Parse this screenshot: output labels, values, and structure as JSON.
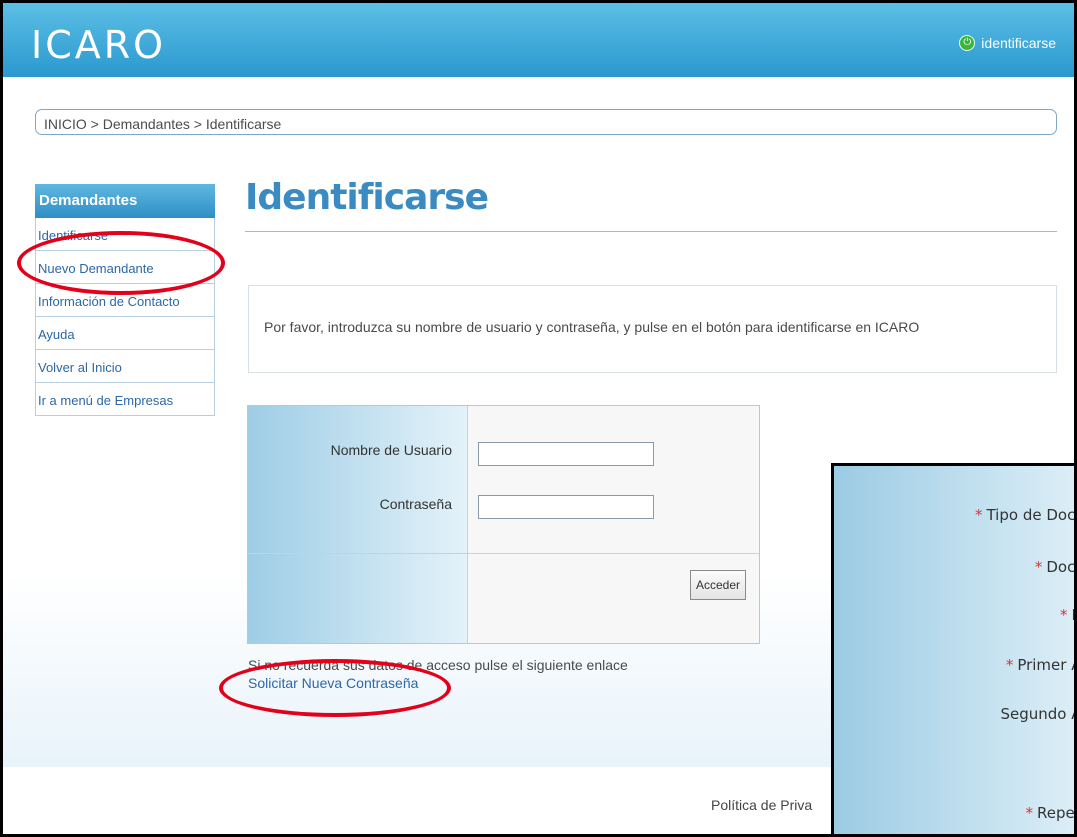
{
  "header": {
    "logo": "ICARO",
    "login_label": "identificarse",
    "login_icon": "power-icon"
  },
  "breadcrumb": "INICIO > Demandantes > Identificarse",
  "sidebar": {
    "title": "Demandantes",
    "items": [
      {
        "label": "Identificarse"
      },
      {
        "label": "Nuevo Demandante"
      },
      {
        "label": "Información de Contacto"
      },
      {
        "label": "Ayuda"
      },
      {
        "label": "Volver al Inicio"
      },
      {
        "label": "Ir a menú de Empresas"
      }
    ]
  },
  "main": {
    "title": "Identificarse",
    "instructions": "Por favor, introduzca su nombre de usuario y contraseña, y pulse en el botón para identificarse en ICARO",
    "form": {
      "username_label": "Nombre de Usuario",
      "username_value": "",
      "password_label": "Contraseña",
      "password_value": "",
      "submit_label": "Acceder"
    },
    "recover_text": "Si no recuerda sus datos de acceso pulse el siguiente enlace",
    "recover_link": "Solicitar Nueva Contraseña"
  },
  "footer": {
    "privacy_text": "Política de Priva"
  },
  "inset_form": {
    "fields": [
      {
        "label": "Tipo de Docur",
        "required": true
      },
      {
        "label": "Docur",
        "required": true
      },
      {
        "label": "Nc",
        "required": true
      },
      {
        "label": "Primer Ap",
        "required": true
      },
      {
        "label": "Segundo Ap",
        "required": false
      },
      {
        "label": "",
        "required": true
      },
      {
        "label": "Repetir",
        "required": true
      }
    ]
  },
  "colors": {
    "header_blue": "#2a98cf",
    "title_blue": "#3a8bc1",
    "link_blue": "#2c67a8",
    "highlight_red": "#e3001b",
    "required_red": "#e03030"
  }
}
